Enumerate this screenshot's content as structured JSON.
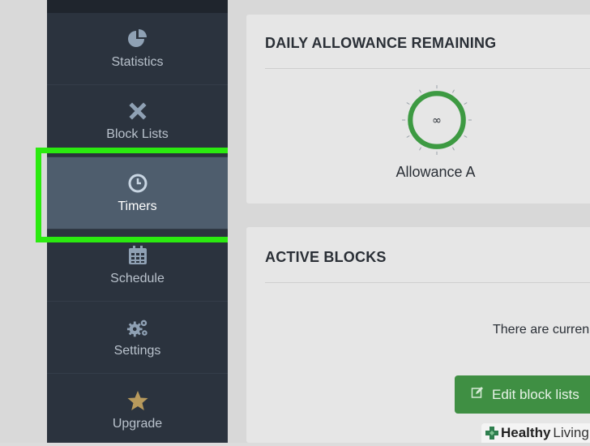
{
  "sidebar": {
    "items": [
      {
        "label": "Statistics",
        "icon": "pie-chart-icon"
      },
      {
        "label": "Block Lists",
        "icon": "x-icon"
      },
      {
        "label": "Timers",
        "icon": "clock-icon",
        "active": true
      },
      {
        "label": "Schedule",
        "icon": "calendar-icon"
      },
      {
        "label": "Settings",
        "icon": "gears-icon"
      },
      {
        "label": "Upgrade",
        "icon": "star-icon"
      }
    ]
  },
  "daily_allowance": {
    "title": "DAILY ALLOWANCE REMAINING",
    "gauge_value": "∞",
    "label": "Allowance A"
  },
  "active_blocks": {
    "title": "ACTIVE BLOCKS",
    "message": "There are curren"
  },
  "edit_button": {
    "label": "Edit block lists"
  },
  "watermark": {
    "healthy": "Healthy",
    "living": "Living"
  },
  "colors": {
    "sidebar_bg": "#2b333e",
    "active_item_bg": "#4e5d6d",
    "highlight": "#2bea10",
    "gauge": "#3d9a42",
    "button": "#3f8f43",
    "star": "#b89a5c"
  }
}
